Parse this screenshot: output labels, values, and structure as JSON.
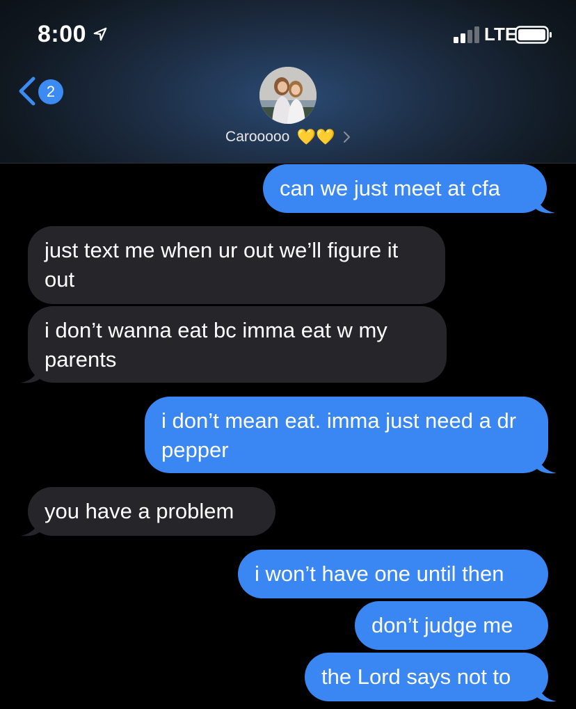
{
  "status_bar": {
    "time": "8:00",
    "network": "LTE",
    "icons": [
      "location-arrow-icon",
      "signal-bars-icon",
      "battery-icon"
    ]
  },
  "header": {
    "back_badge": "2",
    "contact_name": "Carooooo",
    "contact_emoji": "💛💛"
  },
  "colors": {
    "sent_bubble": "#3a87f4",
    "received_bubble": "#26262a",
    "background": "#000000",
    "accent": "#3b8bf2"
  },
  "messages": [
    {
      "from": "me",
      "text": "can we just meet at cfa"
    },
    {
      "from": "them",
      "text": "just text me when ur out we’ll figure it out"
    },
    {
      "from": "them",
      "text": "i don’t wanna eat bc imma eat w my parents"
    },
    {
      "from": "me",
      "text": "i don’t mean eat. imma just need a dr pepper"
    },
    {
      "from": "them",
      "text": "you have a problem"
    },
    {
      "from": "me",
      "text": "i won’t have one until then"
    },
    {
      "from": "me",
      "text": "don’t judge me"
    },
    {
      "from": "me",
      "text": "the Lord says not to"
    }
  ]
}
